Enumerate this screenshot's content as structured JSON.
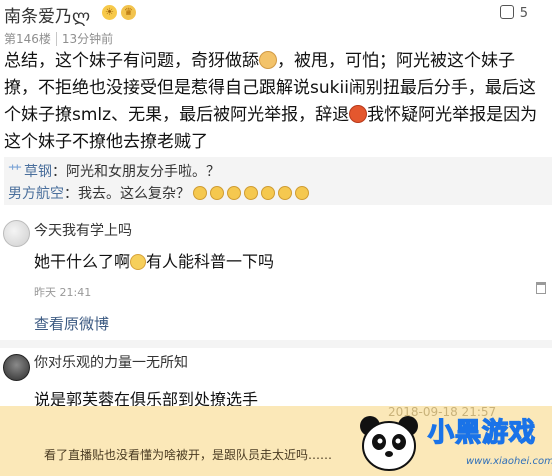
{
  "post": {
    "username": "南条爱乃ლ",
    "badges": [
      "sun-medal-icon",
      "crown-icon"
    ],
    "like_count": "5",
    "floor": "第146楼",
    "time_ago": "13分钟前",
    "body": {
      "part1": "总结，这个妹子有问题，奇犽做舔",
      "part2": "，被甩，可怕；阿光被这个妹子撩，不拒绝也没接受但是惹得自己跟解说sukii闹别扭最后分手，最后这个妹子撩smlz、无果，最后被阿光举报，辞退",
      "part3": "我怀疑阿光举报是因为这个妹子不撩他去撩老贼了"
    }
  },
  "quote": {
    "line1": {
      "prefix": "艹",
      "name": "草钢",
      "text": "：阿光和女朋友分手啦。？"
    },
    "line2": {
      "name": "男方航空",
      "text": "：我去。这么复杂？",
      "emoji_count": 7
    }
  },
  "reply1": {
    "subline": "今天我有学上吗",
    "main_before": "她干什么了啊",
    "main_after": "有人能科普一下吗",
    "time": "昨天 21:41",
    "view_link": "查看原微博"
  },
  "reply2": {
    "subline": "你对乐观的力量一无所知",
    "main": "说是郭芙蓉在俱乐部到处撩选手"
  },
  "footer": {
    "date_stamp": "2018-09-18 21:57",
    "caption": "看了直播贴也没看懂为啥被开，是跟队员走太近吗……",
    "logo_text": "小黑游戏",
    "logo_url": "www.xiaohei.com"
  }
}
